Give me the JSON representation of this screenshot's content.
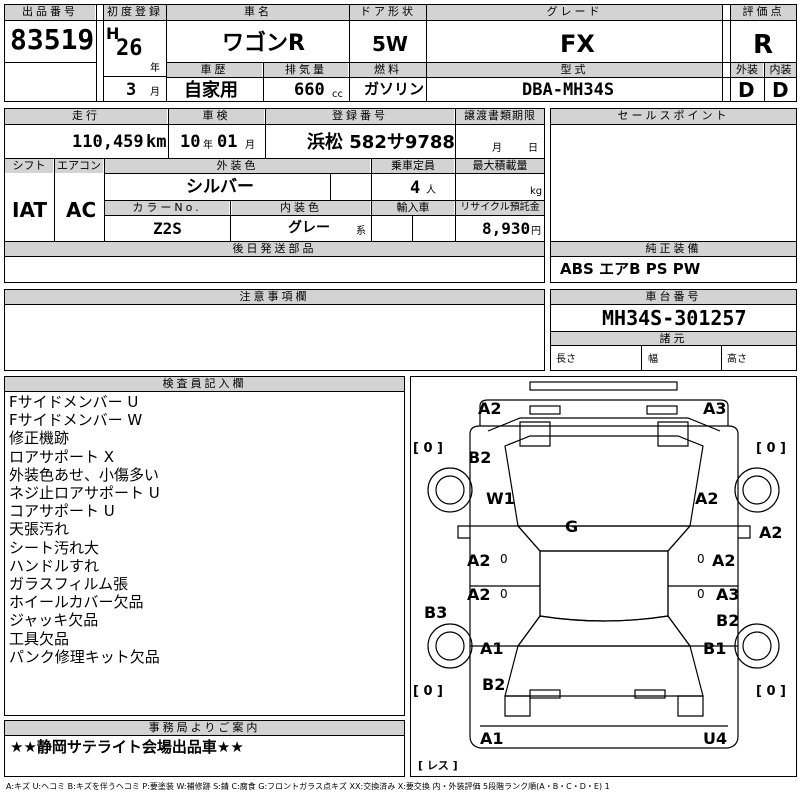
{
  "headers": {
    "lot_no": "出品番号",
    "first_reg": "初度登録",
    "car_name": "車名",
    "door": "ドア形状",
    "grade": "グレード",
    "score": "評価点",
    "history": "車歴",
    "displacement": "排気量",
    "fuel": "燃料",
    "model_code": "型式",
    "exterior": "外装",
    "interior": "内装",
    "mileage": "走行",
    "inspection": "車検",
    "plate": "登録番号",
    "transfer_docs": "譲渡書類期限",
    "sales_point": "セールスポイント",
    "shift": "シフト",
    "aircon": "エアコン",
    "ext_color": "外装色",
    "capacity": "乗車定員",
    "max_load": "最大積載量",
    "color_no": "カラーNo.",
    "int_color": "内装色",
    "import": "輸入車",
    "recycle": "リサイクル預託金",
    "later_parts": "後日発送部品",
    "std_equip": "純正装備",
    "caution": "注意事項欄",
    "chassis": "車台番号",
    "specs": "諸元",
    "inspector": "検査員記入欄",
    "office": "事務局よりご案内"
  },
  "lot_no": "83519",
  "first_reg": {
    "era": "H",
    "year": "26",
    "year_unit": "年",
    "month": "3",
    "month_unit": "月"
  },
  "car_name": "ワゴンR",
  "door": "5W",
  "grade": "FX",
  "score": "R",
  "history": "自家用",
  "displacement": {
    "value": "660",
    "unit": "cc"
  },
  "fuel": "ガソリン",
  "model_code": "DBA-MH34S",
  "exterior_score": "D",
  "interior_score": "D",
  "mileage": {
    "value": "110,459",
    "unit": "km"
  },
  "inspection": {
    "year": "10",
    "year_unit": "年",
    "month": "01",
    "month_unit": "月"
  },
  "plate": "浜松 582サ9788",
  "transfer_docs": {
    "month_unit": "月",
    "day_unit": "日"
  },
  "shift": "IAT",
  "aircon": "AC",
  "ext_color": "シルバー",
  "capacity": {
    "value": "4",
    "unit": "人"
  },
  "max_load": {
    "unit": "kg"
  },
  "color_no": "Z2S",
  "int_color": {
    "value": "グレー",
    "suffix": "系"
  },
  "recycle": {
    "value": "8,930",
    "unit": "円"
  },
  "std_equip": "ABS エアB PS PW",
  "chassis": "MH34S-301257",
  "specs": {
    "length": "長さ",
    "width": "幅",
    "height": "高さ"
  },
  "inspector_notes": [
    "Fサイドメンバー U",
    "Fサイドメンバー W",
    "修正機跡",
    "ロアサポート X",
    "外装色あせ、小傷多い",
    "ネジ止ロアサポート U",
    "コアサポート U",
    "天張汚れ",
    "シート汚れ大",
    "ハンドルすれ",
    "ガラスフィルム張",
    "ホイールカバー欠品",
    "ジャッキ欠品",
    "工具欠品",
    "パンク修理キット欠品"
  ],
  "office_note": "★★静岡サテライト会場出品車★★",
  "diagram": {
    "labels": {
      "front_left": "A2",
      "front_right": "A3",
      "hood_left": "B2",
      "fender_left": "W1",
      "fender_right": "A2",
      "roof": "G",
      "door_fl": "A2",
      "door_fr": "A2",
      "door_rl": "A2",
      "door_rr": "A3",
      "side_left": "B3",
      "side_right": "A2",
      "quarter_rr": "B2",
      "rear_left_a": "A1",
      "rear_left_b": "B2",
      "rear_right": "B1",
      "bumper_rear_left": "A1",
      "bumper_rear_right": "U4"
    },
    "tire_tl": "[ 0 ]",
    "tire_tr": "[ 0 ]",
    "tire_bl": "[ 0 ]",
    "tire_br": "[ 0 ]",
    "spare": "[ レス ]",
    "door_zero": "0"
  },
  "legend": "A:キズ U:ヘコミ B:キズを伴うヘコミ P:要塗装 W:補修跡 S:錆 C:腐食 G:フロントガラス点キズ XX:交換済み X:要交換 内・外装評価 5段階ランク順(A・B・C・D・E) 1"
}
